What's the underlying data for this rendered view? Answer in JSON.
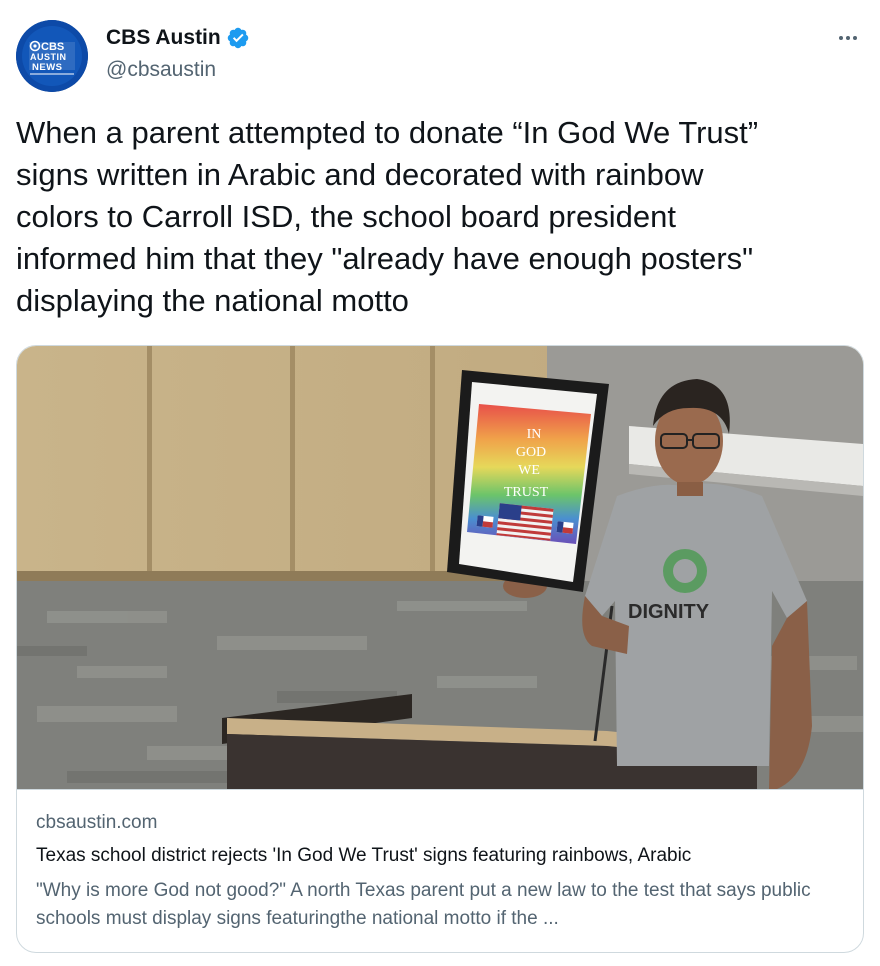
{
  "author": {
    "display_name": "CBS Austin",
    "handle": "@cbsaustin",
    "verified": true,
    "avatar_logo_lines": [
      "CBS",
      "AUSTIN",
      "NEWS"
    ]
  },
  "more_icon": "more-horizontal-icon",
  "tweet": {
    "text": "When a parent attempted to donate “In God We Trust”\nsigns written in Arabic and decorated with rainbow\ncolors to Carroll ISD, the school board president\ninformed him that they \"already have enough posters\"\ndisplaying the national motto"
  },
  "card": {
    "image": {
      "sign_lines": [
        "IN",
        "GOD",
        "WE",
        "TRUST"
      ],
      "shirt_text": "DIGNITY"
    },
    "domain": "cbsaustin.com",
    "title": "Texas school district rejects 'In God We Trust' signs featuring rainbows, Arabic",
    "description": "\"Why is more God not good?\" A north Texas parent put a new law to the test that says public schools must display signs featuringthe national motto if the ..."
  },
  "colors": {
    "text_primary": "#0f1419",
    "text_secondary": "#536471",
    "verified_blue": "#1d9bf0",
    "border": "#cfd9de"
  }
}
